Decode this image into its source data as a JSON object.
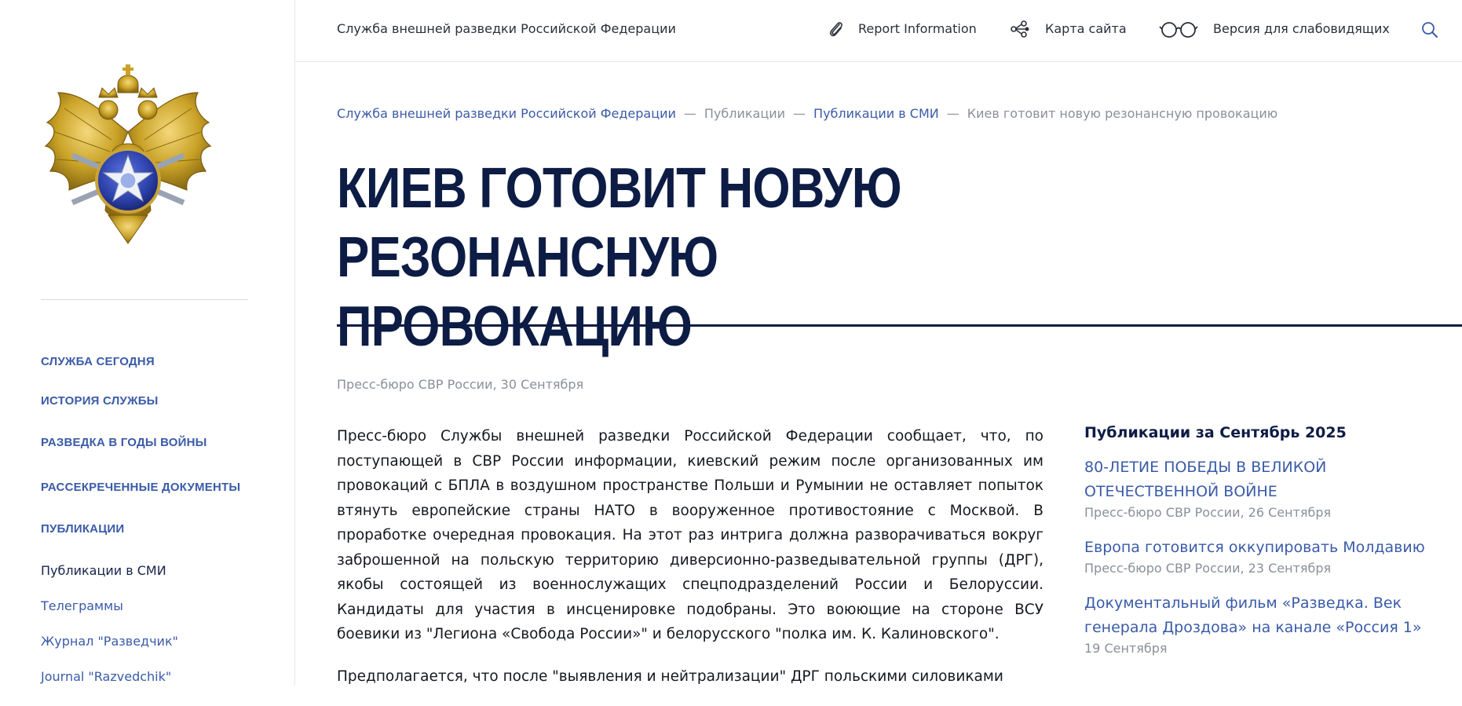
{
  "header": {
    "site_title": "Служба внешней разведки Российской Федерации",
    "report_label": "Report Information",
    "sitemap_label": "Карта сайта",
    "accessibility_label": "Версия для слабовидящих",
    "icons": {
      "report": "paperclip-icon",
      "sitemap": "share-nodes-icon",
      "accessibility": "glasses-icon",
      "search": "search-icon"
    }
  },
  "sidebar": {
    "emblem": "double-headed-eagle-emblem",
    "items": [
      {
        "label": "СЛУЖБА СЕГОДНЯ"
      },
      {
        "label": "ИСТОРИЯ СЛУЖБЫ"
      },
      {
        "label": "РАЗВЕДКА В ГОДЫ ВОЙНЫ"
      },
      {
        "label": "РАССЕКРЕЧЕННЫЕ ДОКУМЕНТЫ"
      },
      {
        "label": "ПУБЛИКАЦИИ"
      }
    ],
    "subitems": [
      {
        "label": "Публикации в СМИ",
        "active": true
      },
      {
        "label": "Телеграммы"
      },
      {
        "label": "Журнал \"Разведчик\""
      },
      {
        "label": "Journal \"Razvedchik\""
      }
    ]
  },
  "breadcrumb": {
    "items": [
      {
        "label": "Служба внешней разведки Российской Федерации"
      },
      {
        "label": "Публикации"
      },
      {
        "label": "Публикации в СМИ"
      },
      {
        "label": "Киев готовит новую резонансную провокацию"
      }
    ],
    "separator": "—"
  },
  "article": {
    "title_line1": "КИЕВ ГОТОВИТ НОВУЮ РЕЗОНАНСНУЮ",
    "title_line2": "ПРОВОКАЦИЮ",
    "byline": "Пресс-бюро СВР России, 30 Сентября",
    "paragraphs": [
      "Пресс-бюро Службы внешней разведки Российской Федерации сообщает, что, по поступающей в СВР России информации, киевский режим после организованных им провокаций с БПЛА в воздушном пространстве Польши и Румынии не оставляет попыток втянуть европейские страны НАТО в вооруженное противостояние с Москвой. В проработке очередная провокация. На этот раз интрига должна разворачиваться вокруг заброшенной на польскую территорию диверсионно-разведывательной группы (ДРГ), якобы состоящей из военнослужащих спецподразделений России и Белоруссии. Кандидаты для участия в инсценировке подобраны. Это воюющие на стороне ВСУ боевики из \"Легиона «Свобода России»\" и белорусского \"полка им. К. Калиновского\".",
      "Предполагается, что после \"выявления и нейтрализации\" ДРГ польскими силовиками"
    ]
  },
  "aside": {
    "title": "Публикации за Сентябрь 2025",
    "items": [
      {
        "title": "80-ЛЕТИЕ ПОБЕДЫ В ВЕЛИКОЙ ОТЕЧЕСТВЕННОЙ ВОЙНЕ",
        "meta": "Пресс-бюро СВР России, 26 Сентября"
      },
      {
        "title": "Европа готовится оккупировать Молдавию",
        "meta": "Пресс-бюро СВР России, 23 Сентября"
      },
      {
        "title": "Документальный фильм «Разведка. Век генерала Дроздова» на канале «Россия 1»",
        "meta": "19 Сентября"
      }
    ]
  },
  "colors": {
    "link": "#3a5ba8",
    "heading": "#0d1c44",
    "muted": "#8a8f9a",
    "emblem_gold": "#c9a227",
    "emblem_blue": "#2b3fa8"
  }
}
